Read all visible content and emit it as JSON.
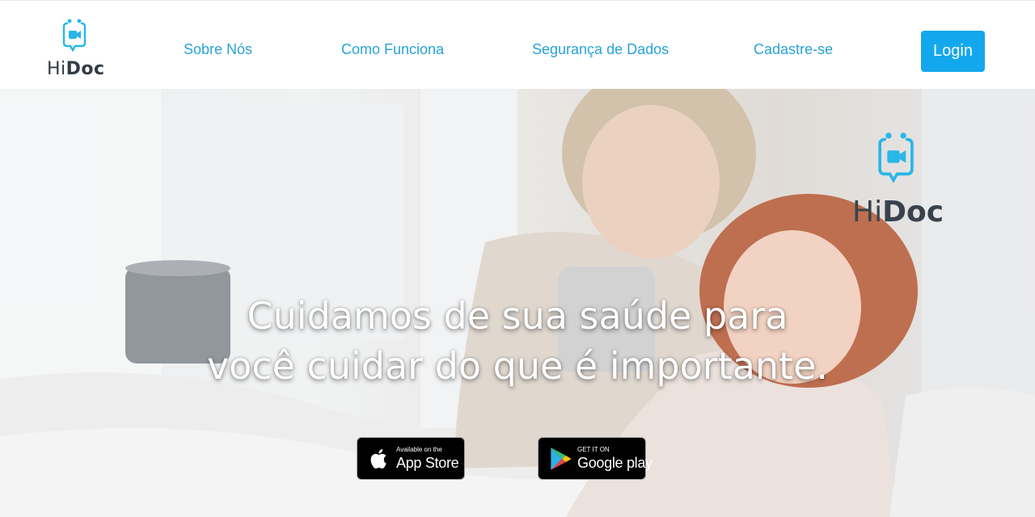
{
  "brand": {
    "name_light": "Hi",
    "name_bold": "Doc",
    "accent": "#29b6e8",
    "text_color": "#333b44"
  },
  "nav": {
    "items": [
      {
        "label": "Sobre Nós"
      },
      {
        "label": "Como Funciona"
      },
      {
        "label": "Segurança de Dados"
      },
      {
        "label": "Cadastre-se"
      }
    ],
    "login_label": "Login",
    "link_color": "#29a3d6",
    "login_color": "#13a8ed"
  },
  "hero": {
    "headline_line1": "Cuidamos de sua saúde para",
    "headline_line2": "você cuidar do que é importante.",
    "logo": {
      "name_light": "Hi",
      "name_bold": "Doc"
    },
    "app_store": {
      "small": "Available on the",
      "big": "App Store"
    },
    "google_play": {
      "small": "GET IT ON",
      "big": "Google play"
    }
  }
}
